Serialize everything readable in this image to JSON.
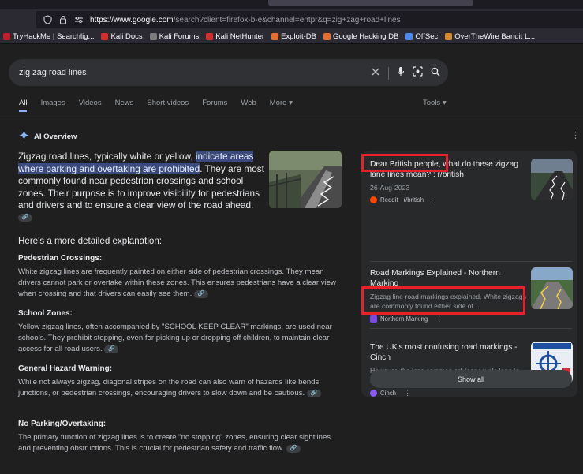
{
  "browser": {
    "url_host": "https://www.google.com",
    "url_rest": "/search?client=firefox-b-e&channel=entpr&q=zig+zag+road+lines",
    "bookmarks": [
      {
        "label": "TryHackMe | Searchlig...",
        "icon": "tryhackme-icon",
        "color": "#c11d2a"
      },
      {
        "label": "Kali Docs",
        "icon": "kali-docs-icon",
        "color": "#d0312d"
      },
      {
        "label": "Kali Forums",
        "icon": "kali-forums-icon",
        "color": "#7a7a7a"
      },
      {
        "label": "Kali NetHunter",
        "icon": "nethunter-icon",
        "color": "#d0312d"
      },
      {
        "label": "Exploit-DB",
        "icon": "exploitdb-icon",
        "color": "#e76d2b"
      },
      {
        "label": "Google Hacking DB",
        "icon": "ghdb-icon",
        "color": "#e76d2b"
      },
      {
        "label": "OffSec",
        "icon": "offsec-icon",
        "color": "#4a8af4"
      },
      {
        "label": "OverTheWire Bandit L...",
        "icon": "otw-icon",
        "color": "#d98a2b"
      }
    ]
  },
  "search": {
    "query": "zig zag road lines"
  },
  "tabs": [
    "All",
    "Images",
    "Videos",
    "News",
    "Short videos",
    "Forums",
    "Web",
    "More"
  ],
  "tools_label": "Tools",
  "ai_overview": {
    "heading": "AI Overview",
    "lead_before": "Zigzag road lines, typically white or yellow, ",
    "lead_highlight": "indicate areas where parking and overtaking are prohibited",
    "lead_after": ". They are most commonly found near pedestrian crossings and school zones. Their purpose is to improve visibility for pedestrians and drivers and to ensure a clear view of the road ahead.",
    "detail_intro": "Here's a more detailed explanation:",
    "sections": [
      {
        "heading": "Pedestrian Crossings:",
        "text": "White zigzag lines are frequently painted on either side of pedestrian crossings. They mean drivers cannot park or overtake within these zones. This ensures pedestrians have a clear view when crossing and that drivers can easily see them."
      },
      {
        "heading": "School Zones:",
        "text": "Yellow zigzag lines, often accompanied by \"SCHOOL KEEP CLEAR\" markings, are used near schools. They prohibit stopping, even for picking up or dropping off children, to maintain clear access for all road users."
      },
      {
        "heading": "General Hazard Warning:",
        "text": "While not always zigzag, diagonal stripes on the road can also warn of hazards like bends, junctions, or pedestrian crossings, encouraging drivers to slow down and be cautious."
      },
      {
        "heading": "No Parking/Overtaking:",
        "text": "The primary function of zigzag lines is to create \"no stopping\" zones, ensuring clear sightlines and preventing obstructions. This is crucial for pedestrian safety and traffic flow."
      }
    ]
  },
  "sources": [
    {
      "title": "Dear British people, what do these zigzag lane lines mean? : r/british",
      "date": "26-Aug-2023",
      "site": "Reddit · r/british",
      "color": "#ff4500"
    },
    {
      "title": "Road Markings Explained - Northern Marking",
      "snippet": "Zigzag line road markings explained. White zigzags are commonly found either side of...",
      "site": "Northern Marking",
      "color": "#7b4ae2"
    },
    {
      "title": "The UK's most confusing road markings - Cinch",
      "snippet": "However, the less common advisory cycle lane is marked with broken white lines and can be...",
      "site": "Cinch",
      "color": "#8a5cf6"
    }
  ],
  "show_all_label": "Show all",
  "colors": {
    "highlight": "#3b4a7d",
    "annotation_red": "#e8202a",
    "accent": "#8ab4f8"
  }
}
